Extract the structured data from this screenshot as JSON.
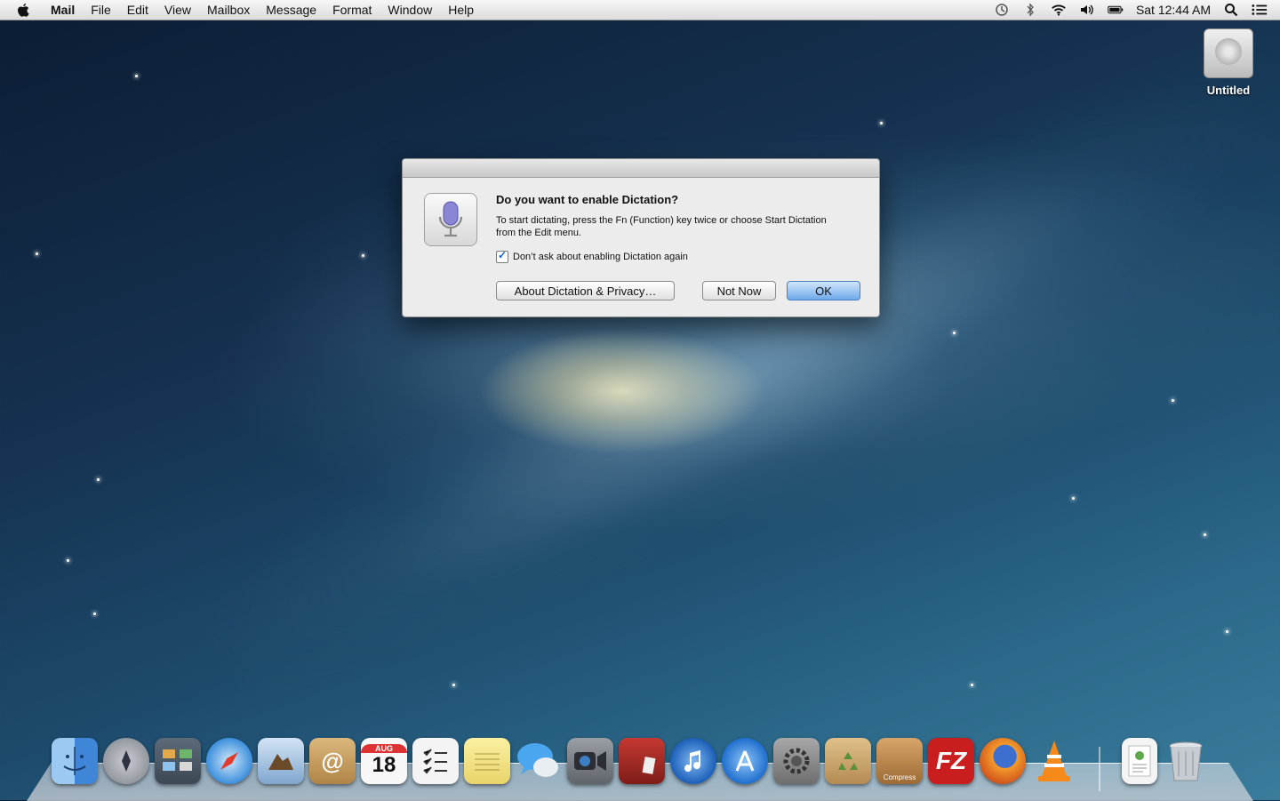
{
  "menubar": {
    "app_name": "Mail",
    "items": [
      "File",
      "Edit",
      "View",
      "Mailbox",
      "Message",
      "Format",
      "Window",
      "Help"
    ],
    "clock": "Sat 12:44 AM",
    "status_icons": [
      "time-machine-icon",
      "bluetooth-icon",
      "wifi-icon",
      "volume-icon",
      "battery-icon",
      "spotlight-icon",
      "notification-center-icon"
    ]
  },
  "desktop": {
    "drive_label": "Untitled"
  },
  "dialog": {
    "title": "Do you want to enable Dictation?",
    "body": "To start dictating, press the Fn (Function) key twice or choose Start Dictation from the Edit menu.",
    "checkbox_label": "Don’t ask about enabling Dictation again",
    "checkbox_checked": true,
    "about_button": "About Dictation & Privacy…",
    "not_now_button": "Not Now",
    "ok_button": "OK"
  },
  "dock": {
    "apps": [
      {
        "name": "finder-icon",
        "color": "#5aa0e8"
      },
      {
        "name": "launchpad-icon",
        "color": "#8a8f98"
      },
      {
        "name": "mission-control-icon",
        "color": "#4b5b6b"
      },
      {
        "name": "safari-icon",
        "color": "#3d8fdc"
      },
      {
        "name": "mail-icon",
        "color": "#8fb1d6"
      },
      {
        "name": "contacts-icon",
        "color": "#c89a55"
      },
      {
        "name": "calendar-icon",
        "color": "#f2f2f2"
      },
      {
        "name": "reminders-icon",
        "color": "#f4f4f4"
      },
      {
        "name": "notes-icon",
        "color": "#f2e27a"
      },
      {
        "name": "messages-icon",
        "color": "#4aa6ee"
      },
      {
        "name": "facetime-icon",
        "color": "#777c84"
      },
      {
        "name": "photo-booth-icon",
        "color": "#b02a24"
      },
      {
        "name": "itunes-icon",
        "color": "#2d79d6"
      },
      {
        "name": "app-store-icon",
        "color": "#2f86e0"
      },
      {
        "name": "system-preferences-icon",
        "color": "#8c8c8c"
      },
      {
        "name": "archive-utility-icon",
        "color": "#c8a268"
      },
      {
        "name": "compress-icon",
        "color": "#b8824a"
      },
      {
        "name": "filezilla-icon",
        "color": "#cc1f1f"
      },
      {
        "name": "firefox-icon",
        "color": "#e6781e"
      },
      {
        "name": "vlc-icon",
        "color": "#f08a1c"
      }
    ],
    "trash_items": [
      {
        "name": "documents-stack-icon",
        "color": "#eeeeee"
      },
      {
        "name": "trash-icon",
        "color": "#c9ced4"
      }
    ],
    "calendar_day": "18",
    "calendar_month": "AUG",
    "filezilla_text": "FZ",
    "compress_text": "Compress"
  }
}
